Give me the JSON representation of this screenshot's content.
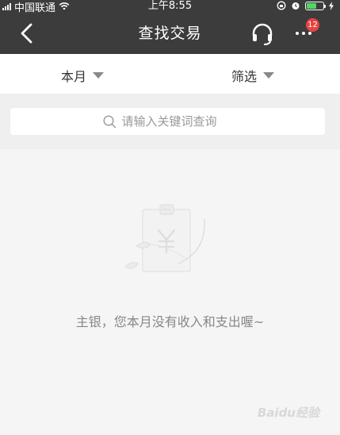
{
  "status_bar": {
    "carrier": "中国联通",
    "time": "上午8:55"
  },
  "nav": {
    "title": "查找交易",
    "more_badge": "12"
  },
  "filters": {
    "month_label": "本月",
    "screen_label": "筛选"
  },
  "search": {
    "placeholder": "请输入关键词查询"
  },
  "empty_state": {
    "message": "主银，您本月没有收入和支出喔~"
  },
  "watermark": {
    "text": "Baidu经验"
  },
  "icons": {
    "back": "chevron-left-icon",
    "headset": "headset-icon",
    "more": "more-dots-icon",
    "search": "search-icon",
    "empty": "empty-bill-icon"
  },
  "colors": {
    "header_bg": "#3c3c3c",
    "badge_bg": "#e84343",
    "page_bg": "#f5f5f5"
  }
}
